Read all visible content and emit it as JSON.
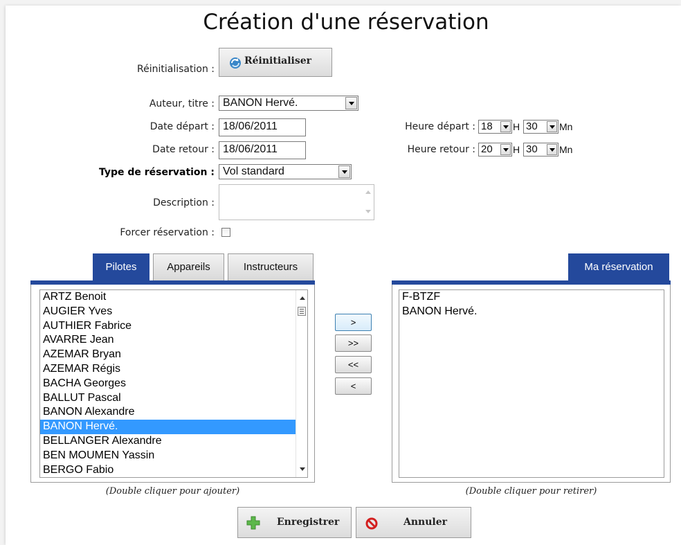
{
  "page": {
    "title": "Création d'une réservation"
  },
  "reset": {
    "label": "Réinitialisation :",
    "button": "Réinitialiser"
  },
  "form": {
    "author_label": "Auteur, titre :",
    "author_value": "BANON Hervé.",
    "date_depart_label": "Date départ :",
    "date_depart_value": "18/06/2011",
    "date_retour_label": "Date retour :",
    "date_retour_value": "18/06/2011",
    "type_label": "Type de réservation :",
    "type_value": "Vol standard",
    "description_label": "Description :",
    "force_label": "Forcer réservation :",
    "heure_depart_label": "Heure départ :",
    "heure_depart_h": "18",
    "heure_depart_mn": "30",
    "heure_retour_label": "Heure retour :",
    "heure_retour_h": "20",
    "heure_retour_mn": "30",
    "h_unit": "H",
    "mn_unit": "Mn"
  },
  "tabs": [
    {
      "label": "Pilotes",
      "active": true
    },
    {
      "label": "Appareils",
      "active": false
    },
    {
      "label": "Instructeurs",
      "active": false
    }
  ],
  "right_tab": {
    "label": "Ma réservation"
  },
  "pilots": [
    "ARTZ Benoit",
    "AUGIER Yves",
    "AUTHIER Fabrice",
    "AVARRE Jean",
    "AZEMAR Bryan",
    "AZEMAR Régis",
    "BACHA Georges",
    "BALLUT Pascal",
    "BANON Alexandre",
    "BANON Hervé.",
    "BELLANGER Alexandre",
    "BEN MOUMEN Yassin",
    "BERGO Fabio"
  ],
  "selected_pilot": "BANON Hervé.",
  "reservation_items": [
    "F-BTZF",
    "BANON Hervé."
  ],
  "move_buttons": {
    "add": ">",
    "add_all": ">>",
    "remove_all": "<<",
    "remove": "<"
  },
  "hints": {
    "add": "(Double cliquer pour ajouter)",
    "remove": "(Double cliquer pour retirer)"
  },
  "actions": {
    "save": "Enregistrer",
    "cancel": "Annuler"
  },
  "colors": {
    "tab_blue": "#24499c",
    "selection": "#3399ff",
    "save_icon": "#5cb84a",
    "cancel_icon": "#d31f1f"
  }
}
